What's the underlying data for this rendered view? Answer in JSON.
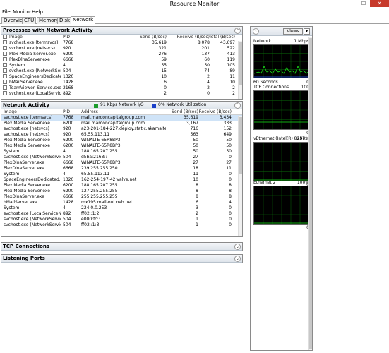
{
  "window": {
    "title": "Resource Monitor",
    "min": "–",
    "max": "☐",
    "close": "✕"
  },
  "menu": [
    "File",
    "Monitor",
    "Help"
  ],
  "tabs": [
    "Overview",
    "CPU",
    "Memory",
    "Disk",
    "Network"
  ],
  "processes": {
    "title": "Processes with Network Activity",
    "headers": {
      "image": "Image",
      "pid": "PID",
      "send": "Send (B/sec)",
      "receive": "Receive (B/sec)",
      "total": "Total (B/sec)"
    },
    "rows": [
      {
        "image": "svchost.exe (termsvcs)",
        "pid": "7768",
        "send": "35,619",
        "receive": "8,078",
        "total": "43,697"
      },
      {
        "image": "svchost.exe (netsvcs)",
        "pid": "920",
        "send": "321",
        "receive": "201",
        "total": "522"
      },
      {
        "image": "Plex Media Server.exe",
        "pid": "6200",
        "send": "276",
        "receive": "137",
        "total": "413"
      },
      {
        "image": "PlexDlnaServer.exe",
        "pid": "6668",
        "send": "59",
        "receive": "60",
        "total": "119"
      },
      {
        "image": "System",
        "pid": "4",
        "send": "55",
        "receive": "50",
        "total": "105"
      },
      {
        "image": "svchost.exe (NetworkService)",
        "pid": "504",
        "send": "15",
        "receive": "74",
        "total": "89"
      },
      {
        "image": "SpaceEngineersDedicated.exe",
        "pid": "1320",
        "send": "10",
        "receive": "2",
        "total": "11"
      },
      {
        "image": "hMailServer.exe",
        "pid": "1428",
        "send": "6",
        "receive": "4",
        "total": "10"
      },
      {
        "image": "TeamViewer_Service.exe",
        "pid": "2168",
        "send": "0",
        "receive": "2",
        "total": "2"
      },
      {
        "image": "svchost.exe (LocalServiceNet...",
        "pid": "892",
        "send": "2",
        "receive": "0",
        "total": "2"
      }
    ]
  },
  "network_activity": {
    "title": "Network Activity",
    "legend1": {
      "color": "#1c9c2c",
      "text": "91 Kbps Network I/O"
    },
    "legend2": {
      "color": "#1a3fc8",
      "text": "0% Network Utilization"
    },
    "headers": {
      "image": "Image",
      "pid": "PID",
      "address": "Address",
      "send": "Send (B/sec)",
      "receive": "Receive (B/sec)"
    },
    "rows": [
      {
        "image": "svchost.exe (termsvcs)",
        "pid": "7768",
        "address": "mail.marooncapitalgroup.com",
        "send": "35,619",
        "receive": "3,434"
      },
      {
        "image": "Plex Media Server.exe",
        "pid": "6200",
        "address": "mail.marooncapitalgroup.com",
        "send": "3,167",
        "receive": "333"
      },
      {
        "image": "svchost.exe (netsvcs)",
        "pid": "920",
        "address": "a23-201-184-227.deploy.static.akamaite...",
        "send": "716",
        "receive": "152"
      },
      {
        "image": "svchost.exe (netsvcs)",
        "pid": "920",
        "address": "65.55.113.11",
        "send": "563",
        "receive": "649"
      },
      {
        "image": "Plex Media Server.exe",
        "pid": "6200",
        "address": "WINALTE-65R8BP3",
        "send": "50",
        "receive": "50"
      },
      {
        "image": "Plex Media Server.exe",
        "pid": "6200",
        "address": "WINALTE-65R8BP3",
        "send": "50",
        "receive": "50"
      },
      {
        "image": "System",
        "pid": "4",
        "address": "188.165.207.255",
        "send": "50",
        "receive": "50"
      },
      {
        "image": "svchost.exe (NetworkService)",
        "pid": "504",
        "address": "d5ba:2163::",
        "send": "27",
        "receive": "0"
      },
      {
        "image": "PlexDlnaServer.exe",
        "pid": "6668",
        "address": "WINALTE-65R8BP3",
        "send": "27",
        "receive": "27"
      },
      {
        "image": "PlexDlnaServer.exe",
        "pid": "6668",
        "address": "239.255.255.250",
        "send": "18",
        "receive": "11"
      },
      {
        "image": "System",
        "pid": "4",
        "address": "65.55.113.11",
        "send": "11",
        "receive": "0"
      },
      {
        "image": "SpaceEngineersDedicated.exe",
        "pid": "1320",
        "address": "162-254-197-42.valve.net",
        "send": "10",
        "receive": "0"
      },
      {
        "image": "Plex Media Server.exe",
        "pid": "6200",
        "address": "188.165.207.255",
        "send": "8",
        "receive": "8"
      },
      {
        "image": "Plex Media Server.exe",
        "pid": "6200",
        "address": "127.255.255.255",
        "send": "8",
        "receive": "8"
      },
      {
        "image": "PlexDlnaServer.exe",
        "pid": "6668",
        "address": "255.255.255.255",
        "send": "8",
        "receive": "8"
      },
      {
        "image": "hMailServer.exe",
        "pid": "1428",
        "address": "mx195.mail-out.ovh.net",
        "send": "6",
        "receive": "4"
      },
      {
        "image": "System",
        "pid": "4",
        "address": "224.0.0.253",
        "send": "3",
        "receive": "0"
      },
      {
        "image": "svchost.exe (LocalServiceNetwo...",
        "pid": "892",
        "address": "ff02::1:2",
        "send": "2",
        "receive": "0"
      },
      {
        "image": "svchost.exe (NetworkService)",
        "pid": "504",
        "address": "e000:fc::",
        "send": "1",
        "receive": "0"
      },
      {
        "image": "svchost.exe (NetworkService)",
        "pid": "504",
        "address": "ff02::1:3",
        "send": "1",
        "receive": "0"
      }
    ]
  },
  "tcp_connections": {
    "title": "TCP Connections"
  },
  "listening_ports": {
    "title": "Listening Ports"
  },
  "right_panel": {
    "views_label": "Views",
    "graphs": [
      {
        "name": "Network",
        "max": "1 Mbps",
        "footer_left": "60 Seconds",
        "footer_right": "0"
      },
      {
        "name": "TCP Connections",
        "max": "100",
        "footer_left": "",
        "footer_right": "0"
      },
      {
        "name": "vEthernet (Intel(R) 8257...",
        "max": "100%",
        "footer_left": "",
        "footer_right": "0"
      },
      {
        "name": "Ethernet 2",
        "max": "100%",
        "footer_left": "",
        "footer_right": "0"
      }
    ]
  }
}
